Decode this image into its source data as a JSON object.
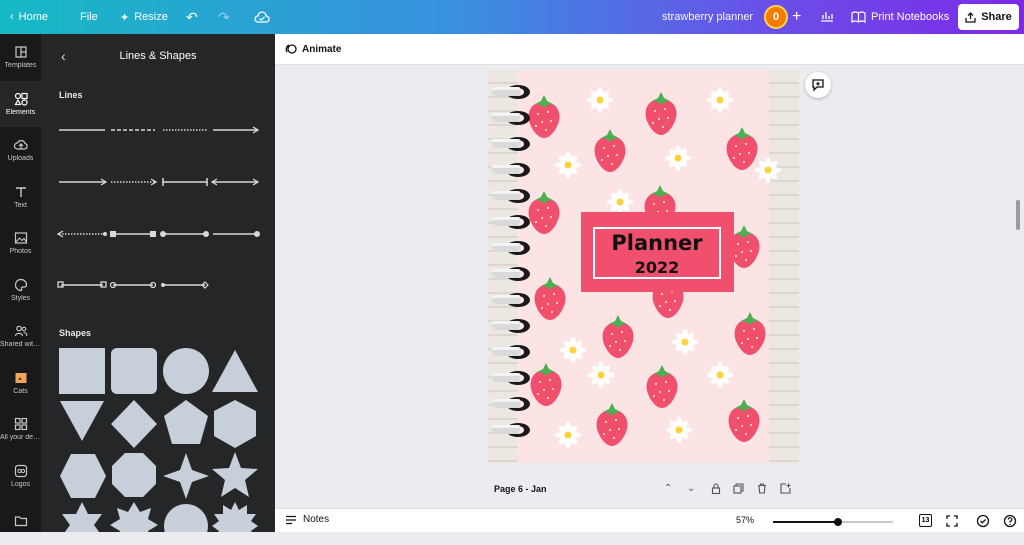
{
  "topbar": {
    "home_label": "Home",
    "file_label": "File",
    "resize_label": "Resize",
    "doc_title": "strawberry planner",
    "avatar_initial": "0",
    "print_label": "Print Notebooks",
    "share_label": "Share",
    "gradient": [
      "#16b9c4",
      "#7d2ae8"
    ]
  },
  "rail": {
    "items": [
      {
        "label": "Templates",
        "icon": "templates-icon"
      },
      {
        "label": "Elements",
        "icon": "elements-icon",
        "active": true
      },
      {
        "label": "Uploads",
        "icon": "uploads-icon"
      },
      {
        "label": "Text",
        "icon": "text-icon"
      },
      {
        "label": "Photos",
        "icon": "photos-icon"
      },
      {
        "label": "Styles",
        "icon": "styles-icon"
      },
      {
        "label": "Shared with ...",
        "icon": "shared-icon"
      },
      {
        "label": "Cats",
        "icon": "cats-icon"
      },
      {
        "label": "All your desi...",
        "icon": "designs-icon"
      },
      {
        "label": "Logos",
        "icon": "logos-icon"
      },
      {
        "label": "",
        "icon": "folder-icon"
      }
    ]
  },
  "panel": {
    "title": "Lines & Shapes",
    "lines_title": "Lines",
    "shapes_title": "Shapes"
  },
  "toolbar": {
    "animate_label": "Animate"
  },
  "design": {
    "title_line1": "Planner",
    "title_line2": "2022",
    "bg_color": "#fce4e4",
    "accent_color": "#f0506e"
  },
  "pagebar": {
    "page_label": "Page 6 - Jan"
  },
  "bottombar": {
    "notes_label": "Notes",
    "zoom_label": "57%",
    "zoom_percent": 57,
    "page_count": "13"
  }
}
